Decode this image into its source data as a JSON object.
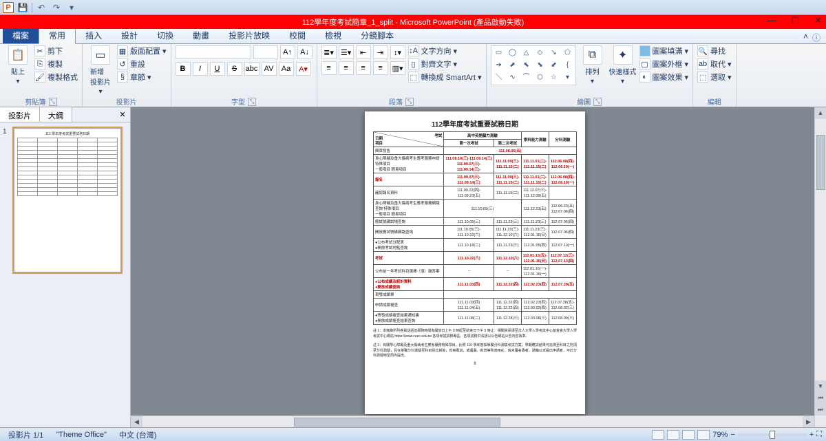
{
  "qat": {
    "app_initial": "P",
    "save_icon": "💾",
    "undo_icon": "↶",
    "redo_icon": "↷"
  },
  "titlebar": {
    "title": "112學年度考試簡章_1_split - Microsoft PowerPoint (產品啟動失敗)"
  },
  "tabs": {
    "file": "檔案",
    "home": "常用",
    "insert": "插入",
    "design": "設計",
    "transitions": "切換",
    "animations": "動畫",
    "slideshow": "投影片放映",
    "review": "校閱",
    "view": "檢視",
    "split": "分鏡腳本"
  },
  "ribbon": {
    "clipboard": {
      "paste": "貼上",
      "cut": "剪下",
      "copy": "複製",
      "format_painter": "複製格式",
      "label": "剪貼簿"
    },
    "slides": {
      "new_slide": "新增\n投影片",
      "layout": "版面配置",
      "reset": "重設",
      "section": "章節",
      "label": "投影片"
    },
    "font": {
      "label": "字型",
      "bold": "B",
      "italic": "I",
      "underline": "U",
      "strike": "S",
      "shadow": "abc",
      "spacing": "AV",
      "case": "Aa",
      "clear": "A"
    },
    "paragraph": {
      "label": "段落",
      "text_direction": "文字方向",
      "align_text": "對齊文字",
      "convert": "轉換成 SmartArt"
    },
    "drawing": {
      "label": "繪圖",
      "arrange": "排列",
      "quick_styles": "快速樣式",
      "fill": "圖案填滿",
      "outline": "圖案外框",
      "effects": "圖案效果"
    },
    "editing": {
      "label": "編輯",
      "find": "尋找",
      "replace": "取代",
      "select": "選取"
    }
  },
  "panel": {
    "slides_tab": "投影片",
    "outline_tab": "大綱",
    "slide_number": "1"
  },
  "status": {
    "slide_info": "投影片 1/1",
    "theme": "\"Theme Office\"",
    "language": "中文 (台灣)",
    "zoom": "79%",
    "fit": "⛶"
  },
  "slide": {
    "title": "112學年度考試重要試務日期",
    "head": {
      "exam": "考試",
      "date": "日期",
      "item": "項目",
      "eng": "高中英語聽力測驗",
      "eng1": "第一次考試",
      "eng2": "第二次考試",
      "abil": "學科能力測驗",
      "subj": "分科測驗"
    },
    "rows": [
      {
        "label": "簡章發售",
        "c": [
          "111.08.05(五)"
        ],
        "span": 4
      },
      {
        "label": "身心障礙及重大傷病考生應考服務申請",
        "sub": [
          "特殊項目",
          "一般項目",
          "輕易項目"
        ],
        "c1": [
          "111.08.10(三)-111.09.14(三)",
          "111.09.07(三)-",
          "111.09.14(三)-"
        ],
        "c2": [
          "",
          "111.11.09(三)-",
          "111.11.15(二)"
        ],
        "c3": [
          "111.11.01(二)-",
          "111.11.15(二)",
          ""
        ],
        "c4": [
          "112.06.08(四)-",
          "112.06.19(一)",
          ""
        ]
      },
      {
        "label": "報名",
        "c1": "111.09.07(三)-\n111.09.14(三)",
        "c2": "111.11.09(三)-\n111.11.15(二)",
        "c3": "111.11.01(二)-\n111.11.15(二)",
        "c4": "112.06.08(四)-\n112.06.19(一)",
        "red": true
      },
      {
        "label": "確認報名資料",
        "c1": "111.09.22(四)-\n111.09.23(五)",
        "c2": "111.11.15(二)",
        "c3": "111.12.07(三)-\n111.12.09(五)",
        "c4": ""
      },
      {
        "label": "身心障礙及重大傷病考生應考服務網路查詢",
        "sub2": [
          "特殊項目",
          "一般項目",
          "輕易項目"
        ],
        "c1": "111.10.05(三)",
        "c3": "111.12.23(五)",
        "c4": "112.06.23(五)\n112.07.06(四)"
      },
      {
        "label": "應試號碼試場查詢",
        "c1": "111.10.05(三)",
        "c2": "111.11.23(三)",
        "c3": "111.11.23(三)",
        "c4": "112.07.06(四)"
      },
      {
        "label": "開放應試號碼網路查詢",
        "c1": "111.10.05(三)-\n111.10.22(六)",
        "c2": "111.11.23(三)-\n111.12.10(六)",
        "c3": "111.11.23(三)-\n112.01.15(日)",
        "c4": "112.07.06(四)"
      },
      {
        "label": "●公布考試分配表\n●開放考試地點查詢",
        "c1": "111.10.18(二)",
        "c2": "111.11.23(三)",
        "c3": "112.01.05(四)",
        "c4": "112.07.10(一)"
      },
      {
        "label": "考試",
        "c1": "111.10.22(六)",
        "c2": "111.12.10(六)",
        "c3": "112.01.13(五)-\n112.01.15(日)",
        "c4": "112.07.12(三)-\n112.07.13(四)",
        "red": true
      },
      {
        "label": "公布前一年考試科目選擇（填）題答案",
        "c1": "–",
        "c2": "–",
        "c3": "112.01.16(一)-\n112.01.16(一)",
        "c4": ""
      },
      {
        "label": "●公布成績及統計資料\n●開放成績查詢",
        "c1": "111.11.03(四)",
        "c2": "111.12.22(四)",
        "c3": "112.02.23(四)",
        "c4": "112.07.28(五)",
        "red": true
      },
      {
        "label": "寄發成績單",
        "c": ""
      },
      {
        "label": "申請成績複查",
        "c1": "111.11.03(四)\n111.11.04(五)",
        "c2": "111.12.22(四)\n111.12.22(四)",
        "c3": "112.02.23(四)\n112.03.02(四)",
        "c4": "112.07.28(五)-\n112.08.02(三)"
      },
      {
        "label": "●寄發成績複查結果通知書\n●開放成績複查結果查詢",
        "c1": "111.11.08(二)",
        "c2": "111.12.28(三)",
        "c3": "112.03.08(三)",
        "c4": "112.08.09(三)"
      }
    ],
    "note1": "註 1：本簡章所列各電話語音服務時間為開放日上午 9 時起至結束日下午 5 時止：相關資訊請至法人大學入學考試中心基金會大學入學考試中心網站 https://www.ceec.edu.tw 各項考試試務專區，各項試務洪清請以公告網站公告內容為準。",
    "note2": "註 2：有關學心障礙及重大傷病考生應考服務特殊項目，比照 110 學年度採單獨分科測驗考試方案，學期應試結果可追溯至科目之則須至分科測驗，且在單獨分科測驗至科目別比對後，有寄專試，或遺漏、新增等所適用在，倘未獲名專者，請輔以未提出申請者，可於分科測驗時至周內提出。",
    "page": "8"
  }
}
